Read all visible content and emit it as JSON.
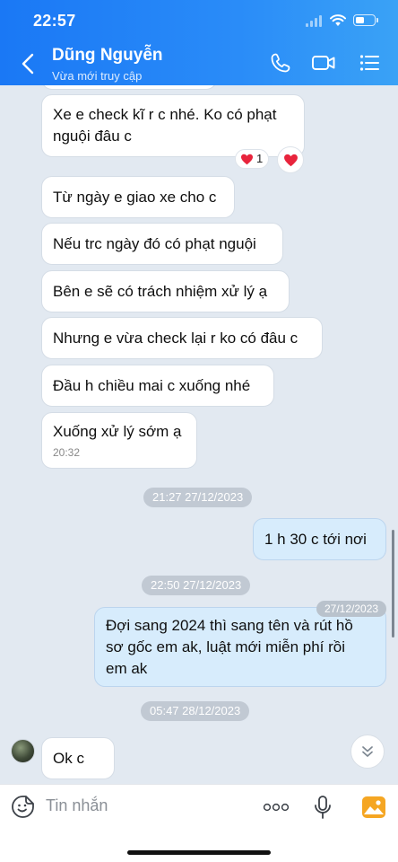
{
  "status_bar": {
    "time": "22:57"
  },
  "header": {
    "contact_name": "Dũng Nguyễn",
    "contact_status": "Vừa mới truy cập",
    "icons": [
      "back-icon",
      "phone-icon",
      "video-call-icon",
      "menu-list-icon"
    ]
  },
  "messages": [
    {
      "direction": "in",
      "lines": [
        "Xe e check kĩ r c nhé. Ko có phạt",
        "nguội đâu c"
      ]
    },
    {
      "direction": "in",
      "lines": [
        "Từ ngày e giao xe cho c"
      ]
    },
    {
      "direction": "in",
      "lines": [
        "Nếu trc ngày đó có phạt nguội"
      ]
    },
    {
      "direction": "in",
      "lines": [
        "Bên e sẽ có trách nhiệm xử lý ạ"
      ]
    },
    {
      "direction": "in",
      "lines": [
        "Nhưng e vừa check lại r ko có đâu c"
      ]
    },
    {
      "direction": "in",
      "lines": [
        "Đầu h chiều mai c xuống nhé"
      ]
    },
    {
      "direction": "in",
      "lines": [
        "Xuống xử lý sớm ạ"
      ],
      "time": "20:32"
    },
    {
      "direction": "out",
      "lines": [
        "1 h 30 c tới nơi"
      ]
    },
    {
      "direction": "out",
      "lines": [
        "Đợi sang 2024 thì sang tên và rút hồ",
        "sơ gốc em ak, luật mới miễn phí rồi",
        "em ak"
      ],
      "date_badge": "27/12/2023"
    },
    {
      "direction": "in",
      "lines": [
        "Ok c"
      ]
    }
  ],
  "reactions": {
    "heart_count": "1",
    "heart_icon": "heart-icon"
  },
  "time_separators": [
    "21:27 27/12/2023",
    "22:50 27/12/2023",
    "05:47 28/12/2023"
  ],
  "input": {
    "placeholder": "Tin nhắn",
    "icons": [
      "sticker-icon",
      "more-icon",
      "microphone-icon",
      "gallery-icon"
    ]
  },
  "colors": {
    "header_start": "#1a78f5",
    "header_end": "#3aa2f6",
    "chat_bg": "#e2e9f1",
    "incoming_bubble": "#ffffff",
    "outgoing_bubble": "#d7ecfc",
    "heart": "#e8243c",
    "gallery_icon": "#f5a623"
  }
}
